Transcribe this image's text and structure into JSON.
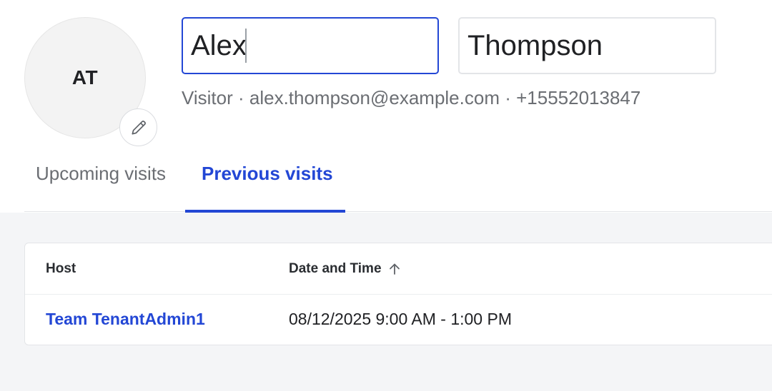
{
  "profile": {
    "initials": "AT",
    "first_name": "Alex",
    "last_name": "Thompson",
    "subline": "Visitor · alex.thompson@example.com · +15552013847"
  },
  "tabs": [
    {
      "label": "Upcoming visits",
      "active": false
    },
    {
      "label": "Previous visits",
      "active": true
    }
  ],
  "table": {
    "columns": [
      "Host",
      "Date and Time"
    ],
    "sort": {
      "column": "Date and Time",
      "direction": "ascending"
    },
    "rows": [
      {
        "host": "Team TenantAdmin1",
        "date_time": "08/12/2025 9:00 AM - 1:00 PM"
      }
    ]
  },
  "icons": {
    "edit": "pencil-icon",
    "sort": "arrow-up-icon"
  },
  "colors": {
    "accent": "#2347d5",
    "muted_text": "#6b6e73",
    "page_background": "#f4f5f7"
  }
}
